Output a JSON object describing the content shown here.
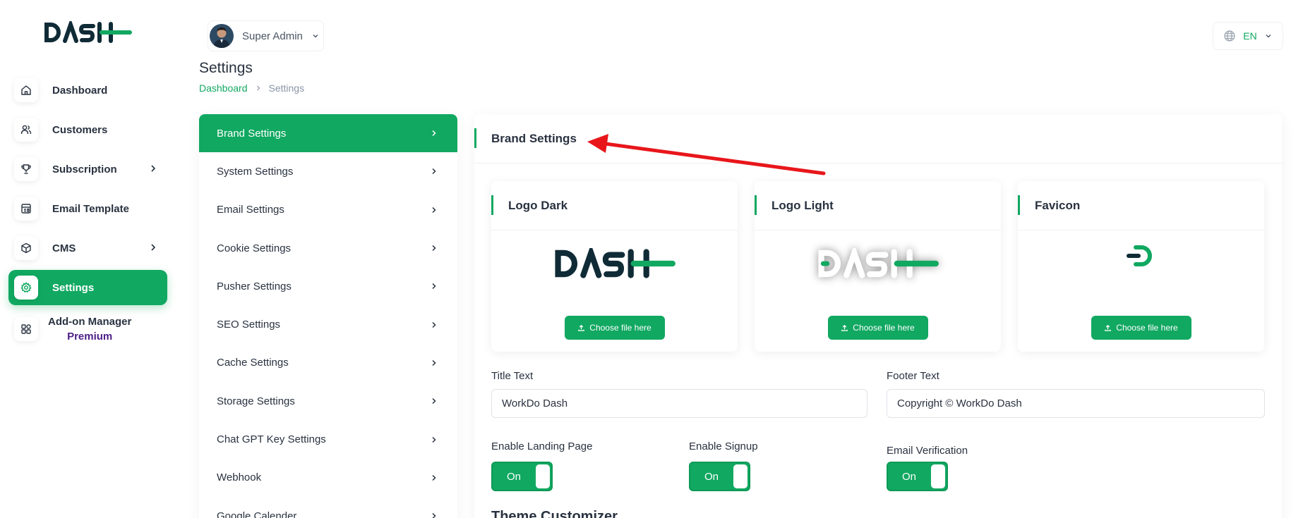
{
  "brand": {
    "logo_text": "DASH"
  },
  "sidebar": {
    "items": [
      {
        "label": "Dashboard",
        "icon": "home-icon"
      },
      {
        "label": "Customers",
        "icon": "users-icon"
      },
      {
        "label": "Subscription",
        "icon": "trophy-icon",
        "has_submenu": true
      },
      {
        "label": "Email Template",
        "icon": "template-icon"
      },
      {
        "label": "CMS",
        "icon": "cube-icon",
        "has_submenu": true
      },
      {
        "label": "Settings",
        "icon": "gear-icon",
        "active": true
      },
      {
        "label": "Add-on Manager",
        "sublabel": "Premium",
        "icon": "grid-icon"
      }
    ]
  },
  "header": {
    "user_name": "Super Admin",
    "language": "EN",
    "page_title": "Settings",
    "breadcrumb": [
      "Dashboard",
      "Settings"
    ]
  },
  "settings_menu": [
    {
      "label": "Brand Settings",
      "active": true
    },
    {
      "label": "System Settings"
    },
    {
      "label": "Email Settings"
    },
    {
      "label": "Cookie Settings"
    },
    {
      "label": "Pusher Settings"
    },
    {
      "label": "SEO Settings"
    },
    {
      "label": "Cache Settings"
    },
    {
      "label": "Storage Settings"
    },
    {
      "label": "Chat GPT Key Settings"
    },
    {
      "label": "Webhook"
    },
    {
      "label": "Google Calender"
    }
  ],
  "brand_settings": {
    "title": "Brand Settings",
    "cards": [
      {
        "title": "Logo Dark",
        "button": "Choose file here"
      },
      {
        "title": "Logo Light",
        "button": "Choose file here"
      },
      {
        "title": "Favicon",
        "button": "Choose file here"
      }
    ],
    "title_text": {
      "label": "Title Text",
      "value": "WorkDo Dash"
    },
    "footer_text": {
      "label": "Footer Text",
      "value": "Copyright © WorkDo Dash"
    },
    "toggles": [
      {
        "label": "Enable Landing Page",
        "state": "On"
      },
      {
        "label": "Enable Signup",
        "state": "On"
      },
      {
        "label": "Email Verification",
        "state": "On"
      }
    ],
    "theme_heading": "Theme Customizer"
  },
  "colors": {
    "accent": "#11a861",
    "dark": "#0f2b36",
    "premium": "#4d1e87",
    "annotation": "#e8161b"
  }
}
